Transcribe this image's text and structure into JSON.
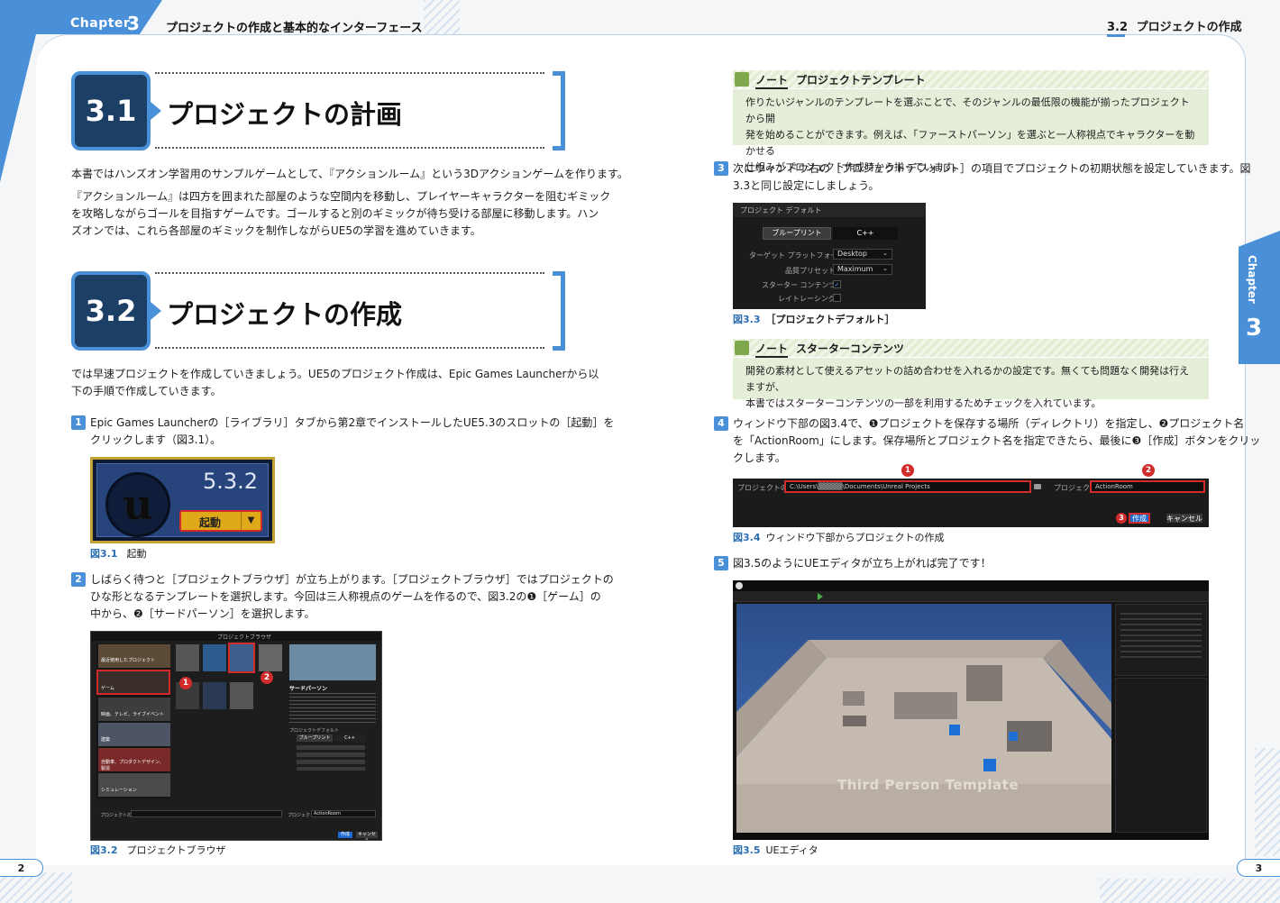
{
  "header": {
    "chapter_label": "Chapter",
    "chapter_number": "3",
    "chapter_title": "プロジェクトの作成と基本的なインターフェース",
    "section_number": "3.2",
    "section_title": "プロジェクトの作成",
    "side_label": "Chapter",
    "side_number": "3"
  },
  "sec31": {
    "number": "3.1",
    "title": "プロジェクトの計画",
    "p1": "本書ではハンズオン学習用のサンプルゲームとして、『アクションルーム』という3Dアクションゲームを作ります。",
    "p2_l1": "『アクションルーム』は四方を囲まれた部屋のような空間内を移動し、プレイヤーキャラクターを阻むギミック",
    "p2_l2": "を攻略しながらゴールを目指すゲームです。ゴールすると別のギミックが待ち受ける部屋に移動します。ハン",
    "p2_l3": "ズオンでは、これら各部屋のギミックを制作しながらUE5の学習を進めていきます。"
  },
  "sec32": {
    "number": "3.2",
    "title": "プロジェクトの作成",
    "intro_l1": "では早速プロジェクトを作成していきましょう。UE5のプロジェクト作成は、Epic Games Launcherから以",
    "intro_l2": "下の手順で作成していきます。"
  },
  "steps": {
    "s1_num": "1",
    "s1_l1": "Epic Games Launcherの［ライブラリ］タブから第2章でインストールしたUE5.3のスロットの［起動］を",
    "s1_l2": "クリックします（図3.1）。",
    "s2_num": "2",
    "s2_l1": "しばらく待つと［プロジェクトブラウザ］が立ち上がります。［プロジェクトブラウザ］ではプロジェクトの",
    "s2_l2": "ひな形となるテンプレートを選択します。今回は三人称視点のゲームを作るので、図3.2の❶［ゲーム］の",
    "s2_l3": "中から、❷［サードパーソン］を選択します。",
    "s3_num": "3",
    "s3_l1": "次にウィンドウ右の［プロジェクトデフォルト］の項目でプロジェクトの初期状態を設定していきます。図",
    "s3_l2": "3.3と同じ設定にしましょう。",
    "s4_num": "4",
    "s4_l1": "ウィンドウ下部の図3.4で、❶プロジェクトを保存する場所（ディレクトリ）を指定し、❷プロジェクト名",
    "s4_l2": "を「ActionRoom」にします。保存場所とプロジェクト名を指定できたら、最後に❸［作成］ボタンをクリッ",
    "s4_l3": "クします。",
    "s5_num": "5",
    "s5_l1": "図3.5のようにUEエディタが立ち上がれば完了です！"
  },
  "fig31": {
    "version": "5.3.2",
    "launch": "起動",
    "cap_num": "図3.1",
    "cap_text": "起動"
  },
  "fig32": {
    "window_title": "プロジェクトブラウザ",
    "cat_recent": "最近使用したプロジェクト",
    "cat_game": "ゲーム",
    "cat_film": "映画、テレビ、ライブイベント",
    "cat_arch": "建築",
    "cat_auto": "自動車、プロダクトデザイン、製造",
    "cat_sim": "シミュレーション",
    "preview_title": "サードパーソン",
    "project_defaults": "プロジェクトデフォルト",
    "blueprint": "ブループリント",
    "cpp": "C++",
    "location_label": "プロジェクトの場所",
    "name_label": "プロジェクト名",
    "name_value": "ActionRoom",
    "create": "作成",
    "cancel": "キャンセル",
    "marker1": "1",
    "marker2": "2",
    "cap_num": "図3.2",
    "cap_text": "プロジェクトブラウザ"
  },
  "note1": {
    "label": "ノート",
    "title": "プロジェクトテンプレート",
    "l1": "作りたいジャンルのテンプレートを選ぶことで、そのジャンルの最低限の機能が揃ったプロジェクトから開",
    "l2": "発を始めることができます。例えば、「ファーストパーソン」を選ぶと一人称視点でキャラクターを動かせる",
    "l3": "仕組みがプロジェクト作成時から揃っています。"
  },
  "fig33": {
    "header": "プロジェクト デフォルト",
    "blueprint": "ブループリント",
    "cpp": "C++",
    "platform_label": "ターゲット プラットフォーム",
    "platform_value": "Desktop",
    "quality_label": "品質プリセット",
    "quality_value": "Maximum",
    "starter_label": "スターター コンテンツ",
    "raytracing_label": "レイトレーシング",
    "cap_num": "図3.3",
    "cap_text": "［プロジェクトデフォルト］"
  },
  "note2": {
    "label": "ノート",
    "title": "スターターコンテンツ",
    "l1": "開発の素材として使えるアセットの詰め合わせを入れるかの設定です。無くても問題なく開発は行えますが、",
    "l2": "本書ではスターターコンテンツの一部を利用するためチェックを入れています。"
  },
  "fig34": {
    "location_label": "プロジェクトの場所",
    "location_value": "C:\\Users\\▒▒▒▒▒\\Documents\\Unreal Projects",
    "name_label": "プロジェクト名",
    "name_value": "ActionRoom",
    "create": "作成",
    "cancel": "キャンセル",
    "marker1": "1",
    "marker2": "2",
    "marker3": "3",
    "cap_num": "図3.4",
    "cap_text": "ウィンドウ下部からプロジェクトの作成"
  },
  "fig35": {
    "level_text": "Third Person Template",
    "cap_num": "図3.5",
    "cap_text": "UEエディタ"
  },
  "page_numbers": {
    "left": "2",
    "right": "3"
  }
}
